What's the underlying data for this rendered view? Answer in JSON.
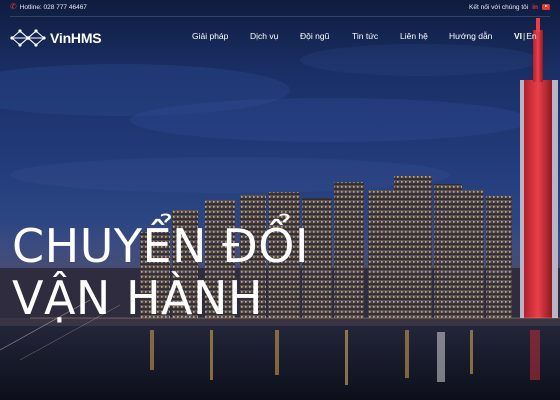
{
  "topbar": {
    "hotline": "Hotline: 028 777 46467",
    "connect": "Kết nối với chúng tôi",
    "linkedin": "in"
  },
  "brand": {
    "name": "VinHMS"
  },
  "nav": {
    "items": [
      {
        "label": "Giải pháp"
      },
      {
        "label": "Dịch vụ"
      },
      {
        "label": "Đội ngũ"
      },
      {
        "label": "Tin tức"
      },
      {
        "label": "Liên hệ"
      },
      {
        "label": "Hướng dẫn"
      }
    ],
    "lang_active": "VI",
    "lang_sep": "|",
    "lang_other": "En"
  },
  "hero": {
    "line1": "CHUYỂN ĐỔI",
    "line2": "VẬN HÀNH"
  },
  "colors": {
    "accent": "#e53935",
    "sky": "#223b7a"
  },
  "icons": [
    "phone-icon",
    "linkedin-icon",
    "youtube-icon",
    "logo-network-icon"
  ]
}
